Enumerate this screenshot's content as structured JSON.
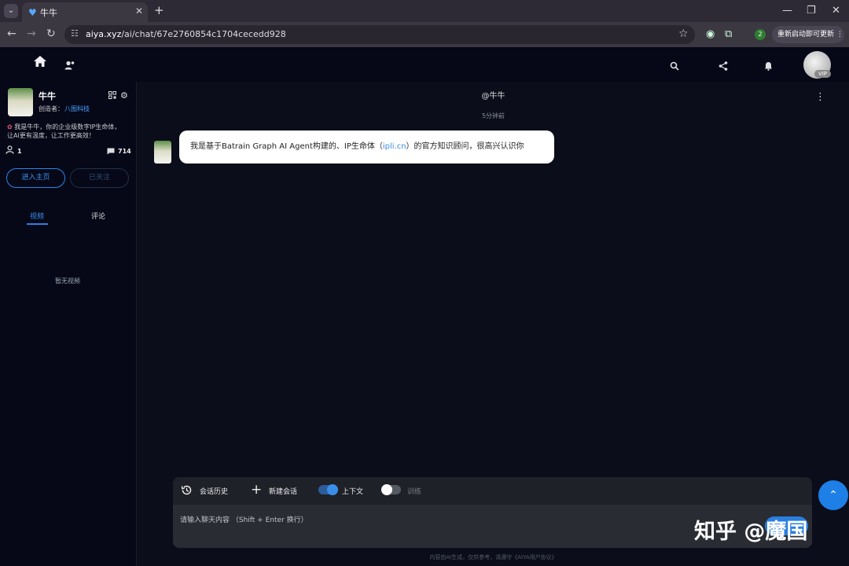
{
  "browser": {
    "tab_title": "牛牛",
    "url_host": "aiya.xyz",
    "url_path": "/ai/chat/67e2760854c1704cecedd928",
    "profile_badge": "2",
    "update_label": "重新启动即可更新"
  },
  "sidebar": {
    "bot_name": "牛牛",
    "creator_label": "创造者：",
    "creator_name": "八图科技",
    "bio_line1": "我是牛牛，你的企业级数字IP生命体，",
    "bio_line2": "让AI更有温度，让工作更高效！",
    "followers": "1",
    "comments": "714",
    "enter_button": "进入主页",
    "follow_button": "已关注",
    "tabs": [
      {
        "label": "视频",
        "active": true
      },
      {
        "label": "评论",
        "active": false
      }
    ],
    "empty_text": "暂无视频"
  },
  "header": {
    "vip_label": "VIP"
  },
  "chat": {
    "title": "@牛牛",
    "timestamp": "5分钟前",
    "message": {
      "before": "我是基于Batrain Graph AI Agent构建的、IP生命体（",
      "link": "ipli.cn",
      "after": "）的官方知识顾问，很高兴认识你"
    },
    "toolbar": {
      "history": "会话历史",
      "new_chat": "新建会话",
      "context": "上下文",
      "context_on": true,
      "training": "训练",
      "training_on": false
    },
    "input_placeholder": "请输入聊天内容 （Shift + Enter 换行）",
    "disclaimer": "内容由AI生成，仅供参考，请遵守《AIYA用户协议》",
    "watermark": "知乎 @魔国"
  },
  "colors": {
    "accent": "#1e7fe6",
    "background": "#0b0d1a",
    "header": "#060818"
  }
}
